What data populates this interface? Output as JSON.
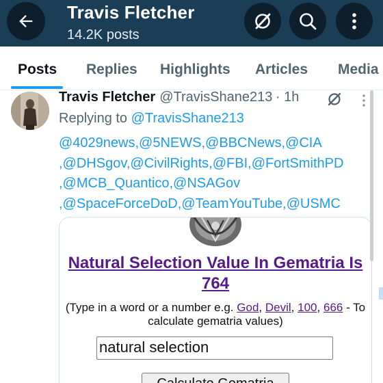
{
  "header": {
    "title": "Travis Fletcher",
    "subtitle": "14.2K posts",
    "bg_color": "#1c3d56",
    "icons": [
      "back-arrow-icon",
      "grok-icon",
      "search-icon",
      "more-vertical-icon"
    ]
  },
  "tabs": [
    {
      "label": "Posts",
      "active": true
    },
    {
      "label": "Replies",
      "active": false
    },
    {
      "label": "Highlights",
      "active": false
    },
    {
      "label": "Articles",
      "active": false
    },
    {
      "label": "Media",
      "active": false
    }
  ],
  "post": {
    "author_name": "Travis Fletcher",
    "author_handle": "@TravisShane213",
    "time": "· 1h",
    "replying_prefix": "Replying to",
    "replying_to": "@TravisShane213",
    "mention_lines": [
      "@4029news,@5NEWS,@BBCNews,@CIA",
      ",@DHSgov,@CivilRights,@FBI,@FortSmithPD",
      ",@MCB_Quantico,@NSAGov",
      ",@SpaceForceDoD,@TeamYouTube,@USMC"
    ],
    "card": {
      "title": "Natural Selection Value In Gematria Is 764",
      "desc_prefix": "(Type in a word or a number e.g.",
      "examples": [
        "God",
        "Devil",
        "100",
        "666"
      ],
      "desc_sep": ",",
      "desc_suffix": "- To calculate gematria values)",
      "input_value": "natural selection",
      "button_label": "Calculate Gematria"
    }
  },
  "colors": {
    "accent": "#1d9bf0",
    "link_visited": "#551a8b"
  }
}
